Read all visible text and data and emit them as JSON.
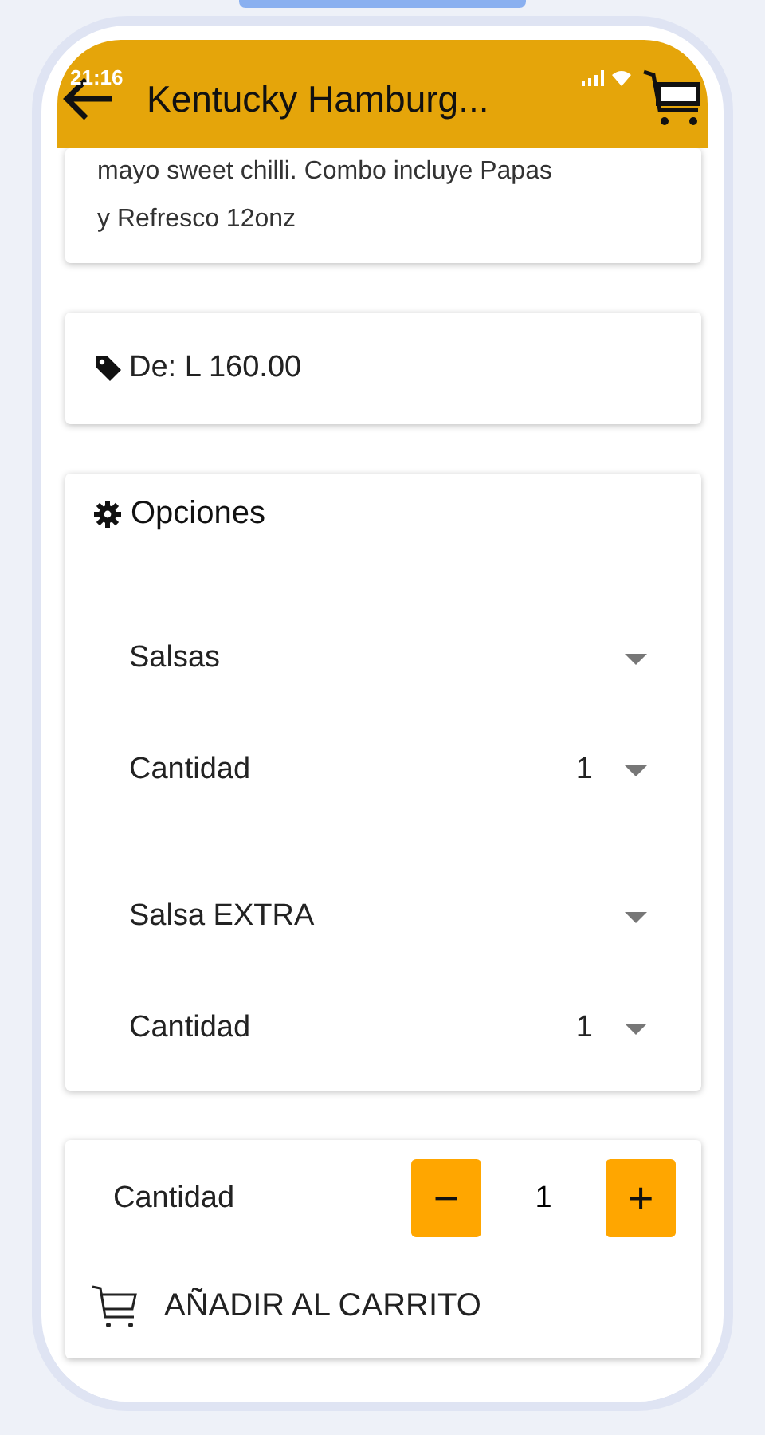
{
  "status_bar": {
    "time": "21:16"
  },
  "header": {
    "title": "Kentucky Hamburg..."
  },
  "description": {
    "lines": [
      "mayo sweet chilli. Combo incluye Papas",
      "y Refresco 12onz"
    ]
  },
  "price": {
    "text": "De: L 160.00"
  },
  "options": {
    "title": "Opciones",
    "groups": [
      {
        "selects": [
          {
            "label": "Salsas"
          },
          {
            "label": "Cantidad",
            "value": "1"
          }
        ]
      },
      {
        "selects": [
          {
            "label": "Salsa EXTRA"
          },
          {
            "label": "Cantidad",
            "value": "1"
          }
        ]
      }
    ]
  },
  "cart": {
    "quantity_label": "Cantidad",
    "minus": "−",
    "quantity": "1",
    "plus": "+",
    "add_button": "AÑADIR AL CARRITO"
  }
}
